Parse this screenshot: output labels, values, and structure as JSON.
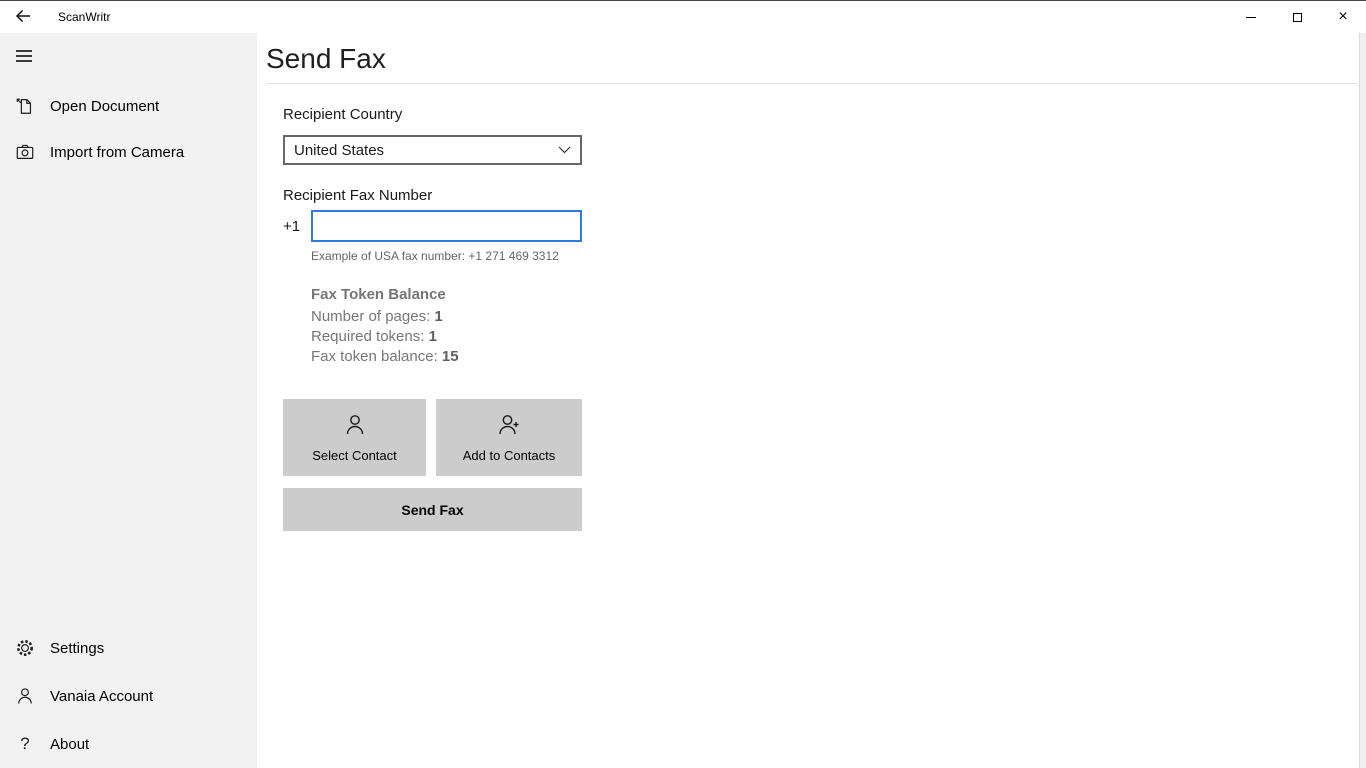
{
  "titlebar": {
    "app_title": "ScanWritr"
  },
  "sidebar": {
    "items": [
      {
        "label": "Open Document",
        "icon": "open-document-icon"
      },
      {
        "label": "Import from Camera",
        "icon": "camera-icon"
      }
    ],
    "bottom_items": [
      {
        "label": "Settings",
        "icon": "gear-icon"
      },
      {
        "label": "Vanaia Account",
        "icon": "person-icon"
      },
      {
        "label": "About",
        "icon": "question-icon",
        "icon_glyph": "?"
      }
    ]
  },
  "main": {
    "title": "Send Fax",
    "recipient_country_label": "Recipient Country",
    "country_value": "United States",
    "recipient_fax_label": "Recipient Fax Number",
    "fax_prefix": "+1",
    "fax_input_value": "",
    "example_text": "Example of USA fax number: +1 271 469 3312",
    "token_balance": {
      "heading": "Fax Token Balance",
      "pages_label": "Number of pages: ",
      "pages_value": "1",
      "tokens_label": "Required tokens: ",
      "tokens_value": "1",
      "balance_label": "Fax token balance: ",
      "balance_value": "15"
    },
    "buttons": {
      "select_contact": "Select Contact",
      "add_to_contacts": "Add to Contacts",
      "send_fax": "Send Fax"
    }
  },
  "colors": {
    "accent": "#2e7cd6",
    "sidebar_bg": "#f2f2f2",
    "button_bg": "#cccccc"
  }
}
